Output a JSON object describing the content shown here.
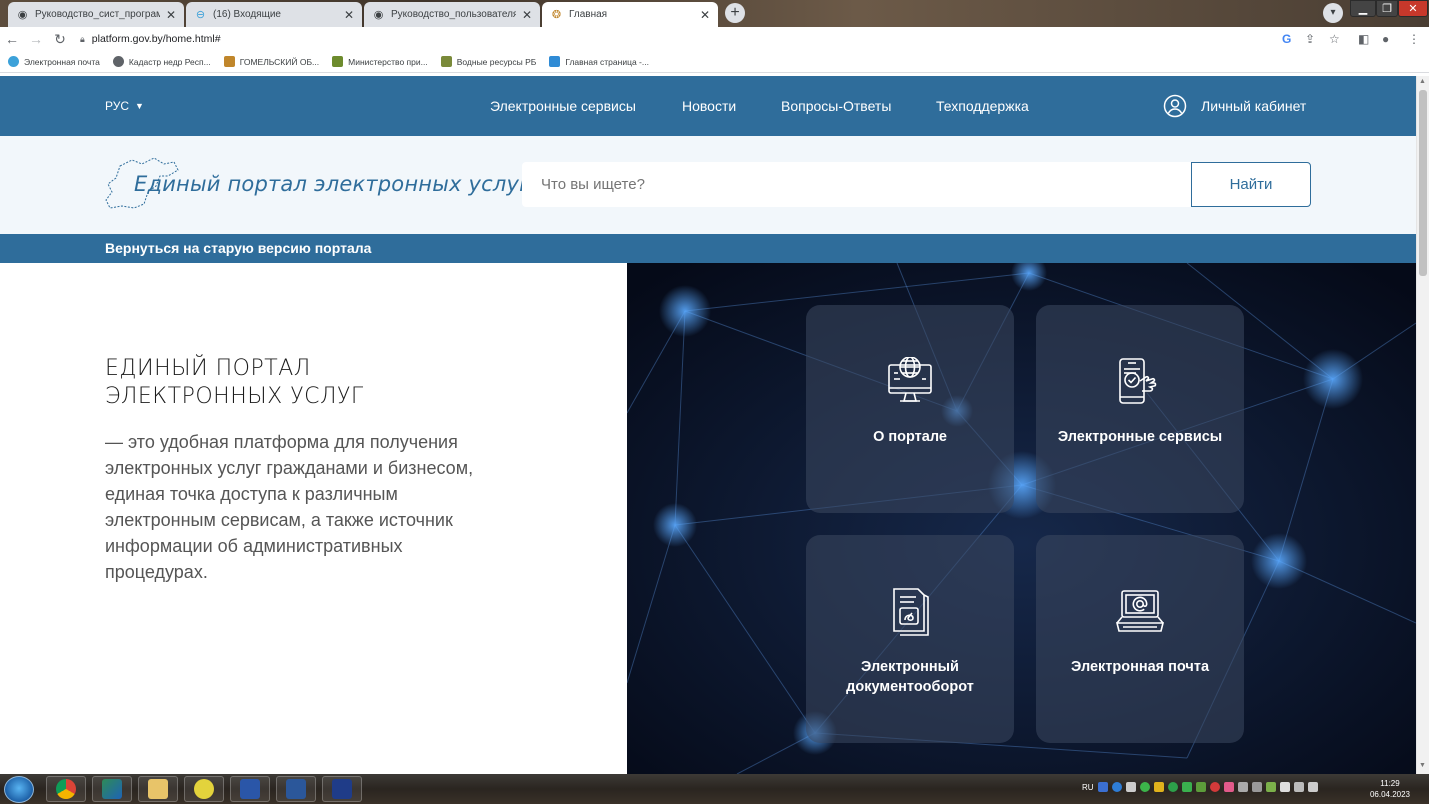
{
  "browser": {
    "tabs": [
      {
        "title": "Руководство_сист_программиста",
        "icon": "chrome-doc-icon",
        "active": false
      },
      {
        "title": "(16) Входящие",
        "icon": "mail-icon",
        "active": false
      },
      {
        "title": "Руководство_пользователя_ПОРТ",
        "icon": "chrome-doc-icon",
        "active": false
      },
      {
        "title": "Главная",
        "icon": "coat-of-arms-icon",
        "active": true
      }
    ],
    "close_glyph": "✕",
    "new_tab_glyph": "+",
    "url": "platform.gov.by/home.html#",
    "bookmarks": [
      {
        "label": "Электронная почта",
        "color": "#3ca1d9"
      },
      {
        "label": "Кадастр недр Респ...",
        "color": "#5f6368"
      },
      {
        "label": "ГОМЕЛЬСКИЙ ОБ...",
        "color": "#c0862b"
      },
      {
        "label": "Министерство при...",
        "color": "#6d8b2d"
      },
      {
        "label": "Водные ресурсы РБ",
        "color": "#7a8a3a"
      },
      {
        "label": "Главная страница -...",
        "color": "#2f8bd5"
      }
    ]
  },
  "site": {
    "lang": "РУС",
    "nav": [
      "Электронные сервисы",
      "Новости",
      "Вопросы-Ответы",
      "Техподдержка"
    ],
    "cabinet": "Личный кабинет",
    "logo_text": "Единый портал электронных услуг",
    "search_placeholder": "Что вы ищете?",
    "search_button": "Найти",
    "old_version": "Вернуться на старую версию портала",
    "hero_title_line1": "ЕДИНЫЙ ПОРТАЛ",
    "hero_title_line2": "ЭЛЕКТРОННЫХ УСЛУГ",
    "hero_desc": "— это удобная платформа для получения электронных услуг гражданами и бизнесом, единая точка доступа к различным электронным сервисам, а также источник информации об административных процедурах.",
    "cards": [
      {
        "label": "О портале",
        "icon": "globe-monitor-icon"
      },
      {
        "label": "Электронные сервисы",
        "icon": "phone-touch-icon"
      },
      {
        "label": "Электронный документооборот",
        "icon": "document-icon"
      },
      {
        "label": "Электронная почта",
        "icon": "laptop-email-icon"
      }
    ],
    "brand_color": "#2f6d9b"
  },
  "taskbar": {
    "lang": "RU",
    "time": "11:29",
    "date": "06.04.2023"
  }
}
